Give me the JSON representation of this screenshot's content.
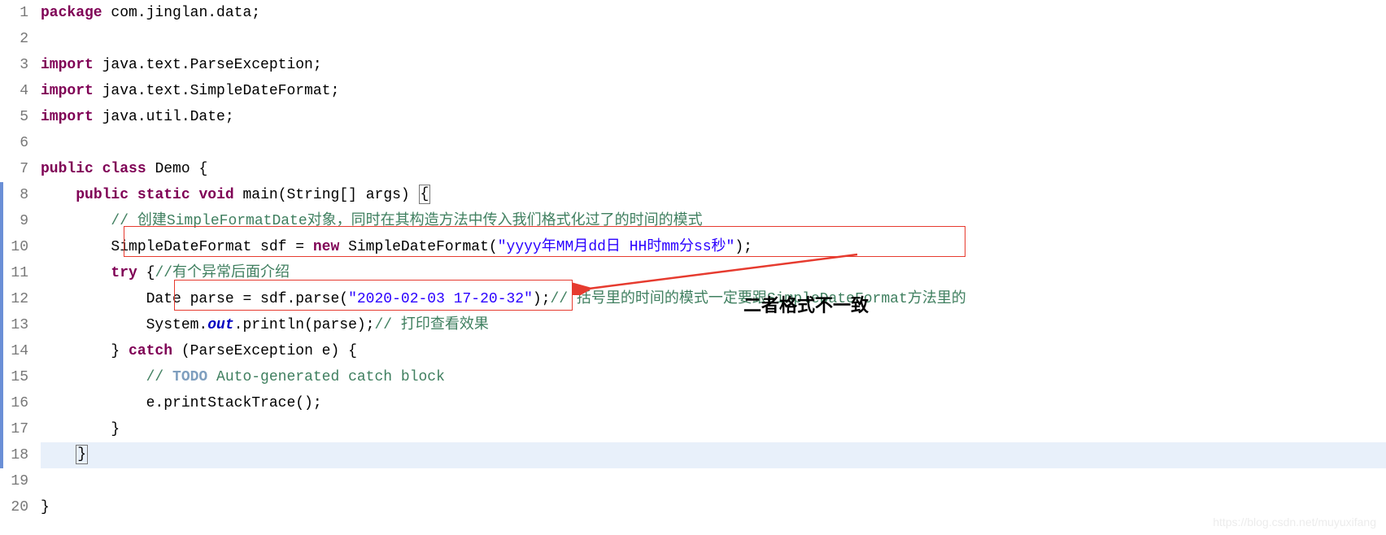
{
  "code": {
    "line1": {
      "kw1": "package",
      "rest": " com.jinglan.data;"
    },
    "line2": "",
    "line3": {
      "kw1": "import",
      "rest": " java.text.ParseException;"
    },
    "line4": {
      "kw1": "import",
      "rest": " java.text.SimpleDateFormat;"
    },
    "line5": {
      "kw1": "import",
      "rest": " java.util.Date;"
    },
    "line6": "",
    "line7": {
      "kw1": "public",
      "sp1": " ",
      "kw2": "class",
      "rest": " Demo {"
    },
    "line8": {
      "indent": "    ",
      "kw1": "public",
      "sp1": " ",
      "kw2": "static",
      "sp2": " ",
      "kw3": "void",
      "rest": " main(String[] args) ",
      "brace": "{"
    },
    "line9": {
      "indent": "        ",
      "comment": "// 创建SimpleFormatDate对象，同时在其构造方法中传入我们格式化过了的时间的模式"
    },
    "line10": {
      "indent": "        ",
      "txt1": "SimpleDateFormat sdf = ",
      "kw1": "new",
      "txt2": " SimpleDateFormat(",
      "str": "\"yyyy年MM月dd日 HH时mm分ss秒\"",
      "txt3": ");"
    },
    "line11": {
      "indent": "        ",
      "kw1": "try",
      "txt1": " {",
      "comment": "//有个异常后面介绍"
    },
    "line12": {
      "indent": "            ",
      "txt1": "Date parse = sdf.parse(",
      "str": "\"2020-02-03 17-20-32\"",
      "txt2": ");",
      "comment": "// 括号里的时间的模式一定要跟SimpleDateFormat方法里的"
    },
    "line13": {
      "indent": "            ",
      "txt1": "System.",
      "out": "out",
      "txt2": ".println(parse);",
      "comment": "// 打印查看效果"
    },
    "line14": {
      "indent": "        ",
      "txt1": "} ",
      "kw1": "catch",
      "txt2": " (ParseException e) {"
    },
    "line15": {
      "indent": "            ",
      "cslash": "// ",
      "todo": "TODO",
      "crest": " Auto-generated catch block"
    },
    "line16": {
      "indent": "            ",
      "txt1": "e.printStackTrace();"
    },
    "line17": {
      "indent": "        ",
      "txt1": "}"
    },
    "line18": {
      "indent": "    ",
      "txt1": "}"
    },
    "line19": "",
    "line20": {
      "txt1": "}"
    }
  },
  "gutter": {
    "n1": "1",
    "n2": "2",
    "n3": "3",
    "n4": "4",
    "n5": "5",
    "n6": "6",
    "n7": "7",
    "n8": "8",
    "n9": "9",
    "n10": "10",
    "n11": "11",
    "n12": "12",
    "n13": "13",
    "n14": "14",
    "n15": "15",
    "n16": "16",
    "n17": "17",
    "n18": "18",
    "n19": "19",
    "n20": "20"
  },
  "annotation": {
    "label": "二者格式不一致"
  },
  "watermark": "https://blog.csdn.net/muyuxifang"
}
